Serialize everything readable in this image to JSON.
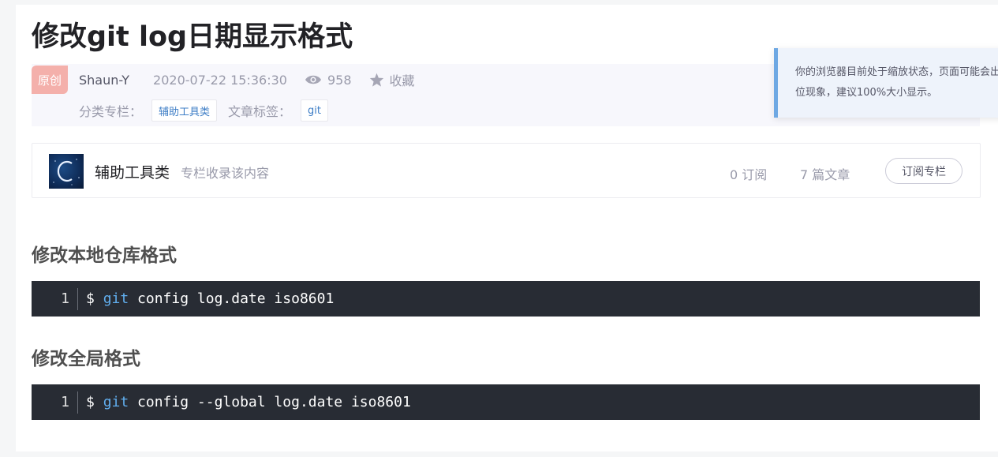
{
  "article": {
    "title": "修改git log日期显示格式",
    "original_badge": "原创",
    "author": "Shaun-Y",
    "date": "2020-07-22 15:36:30",
    "views": "958",
    "collect_label": "收藏",
    "category_label": "分类专栏：",
    "category_tag": "辅助工具类",
    "tags_label": "文章标签：",
    "tag": "git"
  },
  "column": {
    "name": "辅助工具类",
    "description": "专栏收录该内容",
    "subscribers": "0 订阅",
    "articles": "7 篇文章",
    "subscribe_label": "订阅专栏"
  },
  "sections": [
    {
      "heading": "修改本地仓库格式",
      "line_number": "1",
      "code_prompt": "$ ",
      "code_keyword": "git",
      "code_rest": " config log.date iso8601"
    },
    {
      "heading": "修改全局格式",
      "line_number": "1",
      "code_prompt": "$ ",
      "code_keyword": "git",
      "code_rest": " config --global log.date iso8601"
    }
  ],
  "toast": {
    "line1": "你的浏览器目前处于缩放状态，页面可能会出现错",
    "line2": "位现象，建议100%大小显示。"
  },
  "colors": {
    "code_bg": "#282c34",
    "code_keyword": "#61aeee",
    "tag_text": "#3e7ec6",
    "badge_bg": "#f4b0ab",
    "toast_accent": "#6ea8e3"
  },
  "icons": {
    "views": "eye-icon",
    "collect": "star-icon",
    "column_avatar": "column-cover-image"
  }
}
